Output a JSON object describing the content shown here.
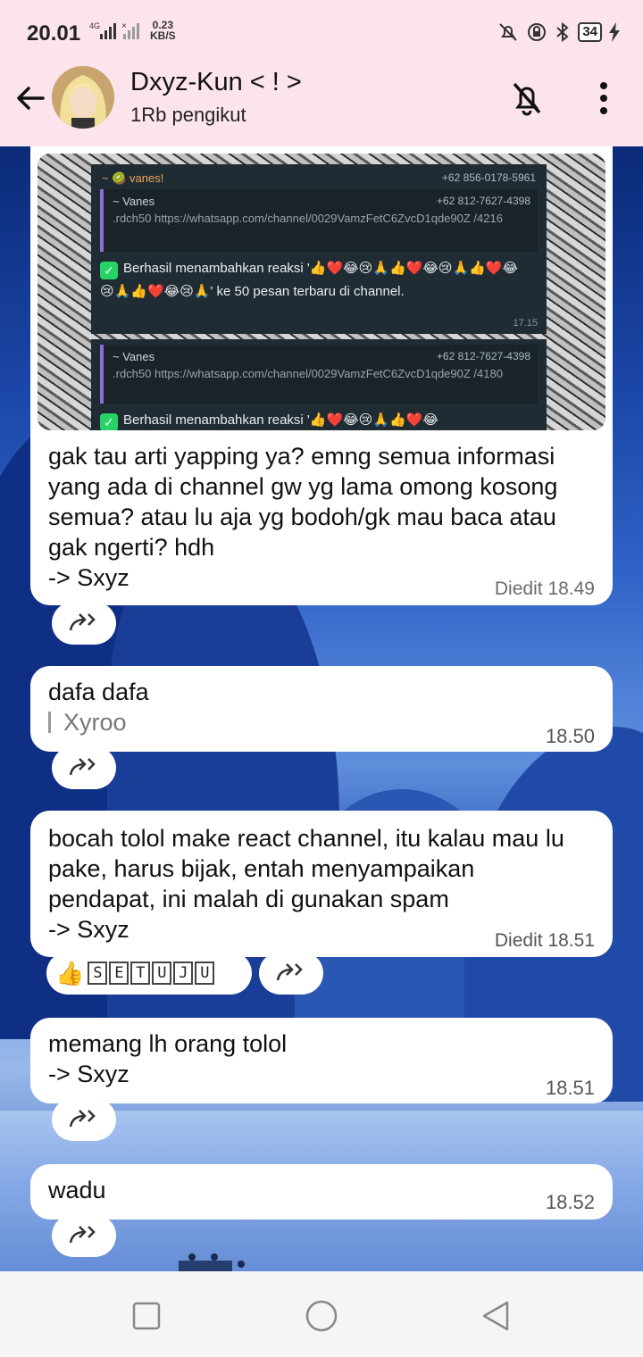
{
  "status_bar": {
    "time": "20.01",
    "net_speed_value": "0.23",
    "net_speed_unit": "KB/S",
    "battery": "34"
  },
  "header": {
    "channel_name": "Dxyz-Kun < ! >",
    "followers": "1Rb pengikut"
  },
  "embedded_screenshot": {
    "sender": "~ 🥝 vanes!",
    "sender_phone": "+62 856-0178-5961",
    "quote1": {
      "name": "~ Vanes",
      "phone": "+62 812-7627-4398",
      "text": ".rdch50 https://whatsapp.com/channel/0029VamzFetC6ZvcD1qde90Z /4216"
    },
    "reply_text": "Berhasil menambahkan reaksi '👍❤️😂😢🙏👍❤️😂😢🙏👍❤️😂😢🙏👍❤️😂😢🙏' ke 50 pesan terbaru di channel.",
    "reply_time": "17.15",
    "quote2": {
      "name": "~ Vanes",
      "phone": "+62 812-7627-4398",
      "text": ".rdch50 https://whatsapp.com/channel/0029VamzFetC6ZvcD1qde90Z /4180"
    },
    "reply_text2": "Berhasil menambahkan reaksi '👍❤️😂😢🙏👍❤️😂"
  },
  "messages": [
    {
      "text": "gak tau arti yapping ya? emng semua informasi yang ada di channel gw yg lama omong kosong semua? atau lu aja yg bodoh/gk mau baca atau gak ngerti? hdh\n-> Sxyz",
      "edited_label": "Diedit",
      "time": "18.49"
    },
    {
      "text": "dafa dafa",
      "signature": "Xyroo",
      "time": "18.50"
    },
    {
      "text": "bocah tolol make react channel, itu kalau mau lu pake, harus bijak, entah menyampaikan pendapat, ini malah di gunakan spam\n-> Sxyz",
      "edited_label": "Diedit",
      "time": "18.51",
      "reaction": {
        "emoji": "👍",
        "letters": [
          "S",
          "E",
          "T",
          "U",
          "J",
          "U"
        ]
      }
    },
    {
      "text": "memang lh orang tolol\n-> Sxyz",
      "time": "18.51"
    },
    {
      "text": "wadu",
      "time": "18.52"
    }
  ]
}
